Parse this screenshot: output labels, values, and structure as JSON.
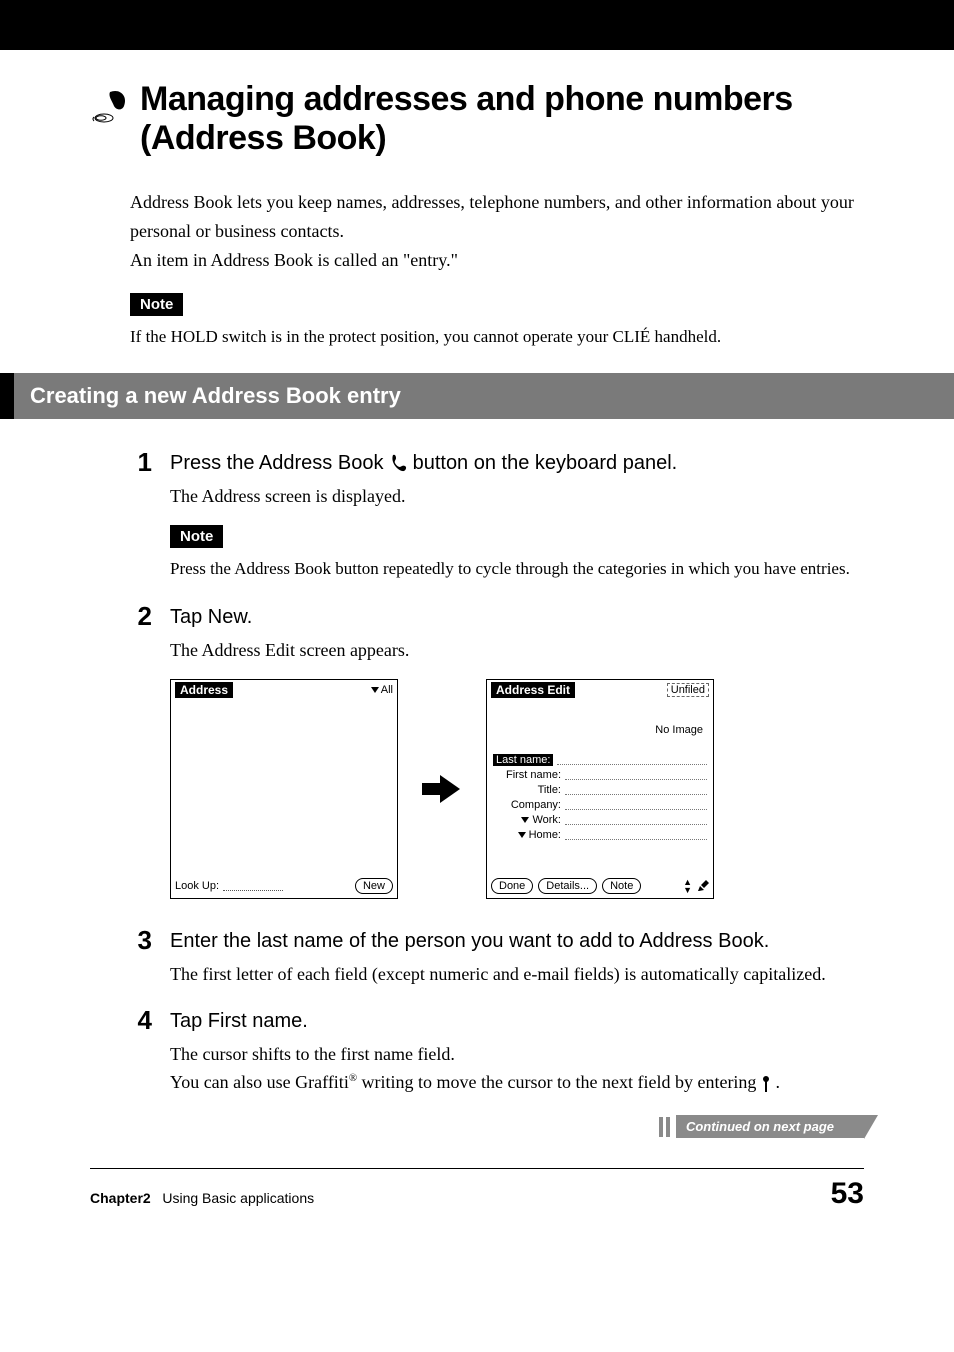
{
  "title": "Managing addresses and phone numbers (Address Book)",
  "intro_p1": "Address Book lets you keep names, addresses, telephone numbers, and other information about your personal or business contacts.",
  "intro_p2": "An item in Address Book is called an \"entry.\"",
  "note_label": "Note",
  "top_note_text": "If the HOLD switch is in the protect position, you cannot operate your CLIÉ handheld.",
  "section_heading": "Creating a new Address Book entry",
  "steps": {
    "s1": {
      "num": "1",
      "heading_before": "Press the Address Book ",
      "heading_after": " button on the keyboard panel.",
      "desc": "The Address screen is displayed.",
      "note_text": "Press the Address Book button repeatedly to cycle through the categories in which you have entries."
    },
    "s2": {
      "num": "2",
      "heading": "Tap New.",
      "desc": "The Address Edit screen appears."
    },
    "s3": {
      "num": "3",
      "heading": "Enter the last name of the person you want to add to Address Book.",
      "desc": "The first letter of each field (except numeric and e-mail fields) is automatically capitalized."
    },
    "s4": {
      "num": "4",
      "heading": "Tap First name.",
      "desc1": "The cursor shifts to the first name field.",
      "desc2a": "You can also use Graffiti",
      "desc2b": " writing to move the cursor to the next field by entering ",
      "desc2c": " ."
    }
  },
  "fig_left": {
    "title": "Address",
    "category": "All",
    "lookup": "Look Up:",
    "new_btn": "New"
  },
  "fig_right": {
    "title": "Address Edit",
    "category": "Unfiled",
    "noimage": "No Image",
    "fields": {
      "last": "Last name:",
      "first": "First name:",
      "title": "Title:",
      "company": "Company:",
      "work": "Work:",
      "home": "Home:"
    },
    "done": "Done",
    "details": "Details...",
    "note": "Note"
  },
  "reg_mark": "®",
  "continued": "Continued on next page",
  "footer": {
    "chapter_label": "Chapter2",
    "chapter_title": "Using Basic applications",
    "page_number": "53"
  }
}
